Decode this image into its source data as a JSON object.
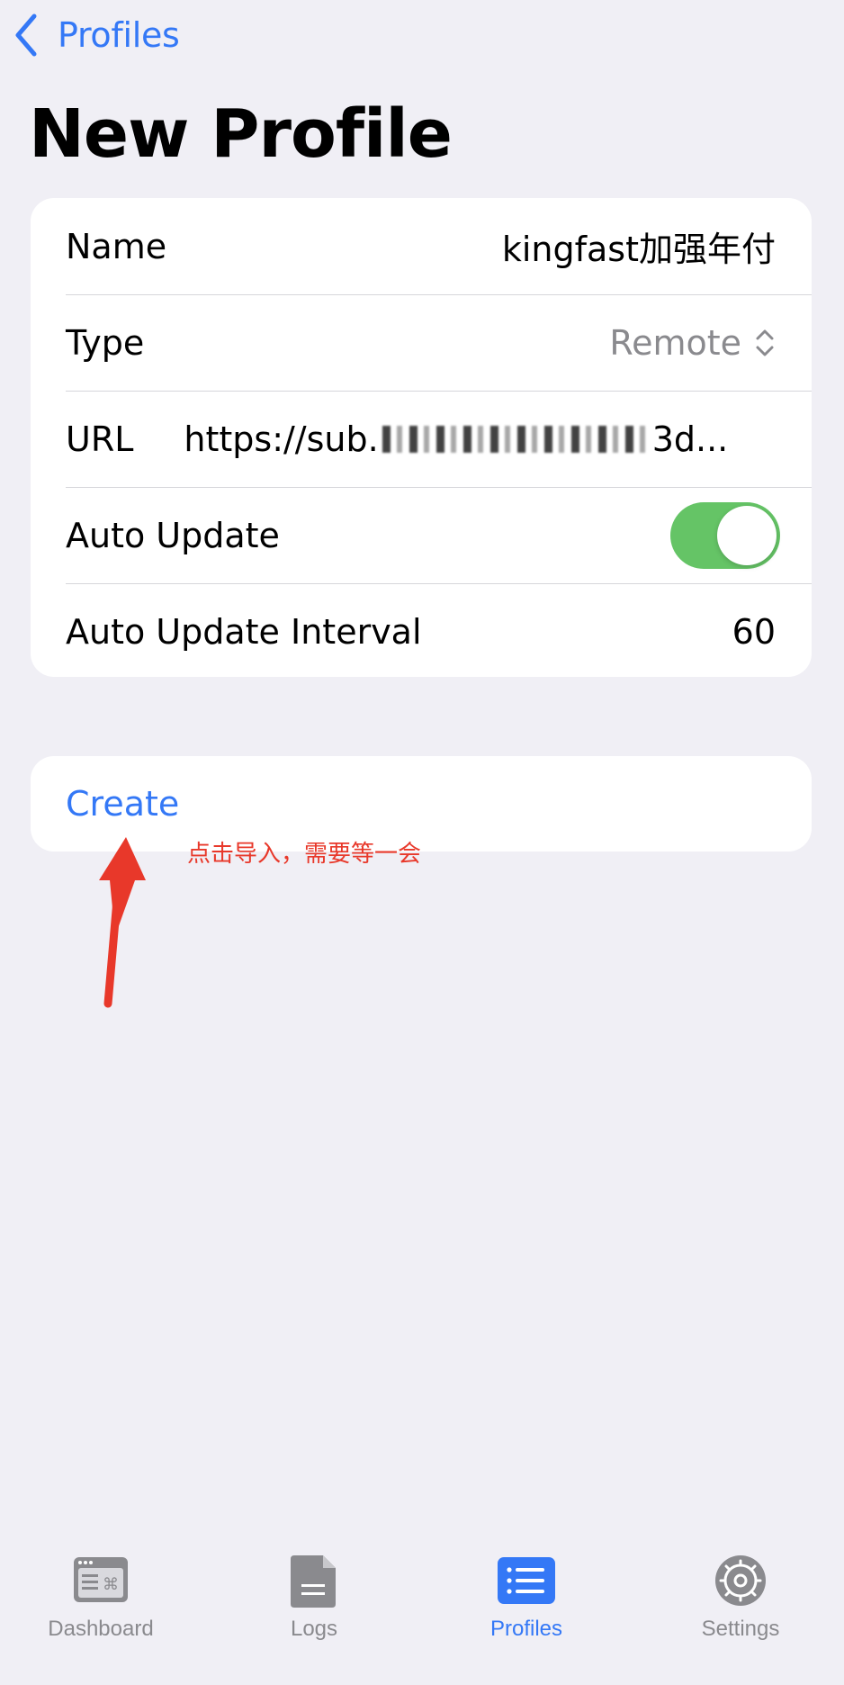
{
  "nav": {
    "back_label": "Profiles"
  },
  "page": {
    "title": "New Profile"
  },
  "form": {
    "name_label": "Name",
    "name_value": "kingfast加强年付",
    "type_label": "Type",
    "type_value": "Remote",
    "url_label": "URL",
    "url_value_prefix": "https://sub.",
    "url_value_suffix": "3d...",
    "auto_update_label": "Auto Update",
    "auto_update_on": true,
    "interval_label": "Auto Update Interval",
    "interval_value": "60"
  },
  "actions": {
    "create_label": "Create"
  },
  "annotation": {
    "text": "点击导入，需要等一会"
  },
  "tabbar": {
    "tabs": [
      {
        "label": "Dashboard",
        "icon": "dashboard-icon",
        "active": false
      },
      {
        "label": "Logs",
        "icon": "document-icon",
        "active": false
      },
      {
        "label": "Profiles",
        "icon": "list-icon",
        "active": true
      },
      {
        "label": "Settings",
        "icon": "gear-icon",
        "active": false
      }
    ]
  },
  "colors": {
    "accent": "#3478f6",
    "toggle_on": "#65c466",
    "annotation": "#e8382a",
    "background": "#f0eff5"
  }
}
